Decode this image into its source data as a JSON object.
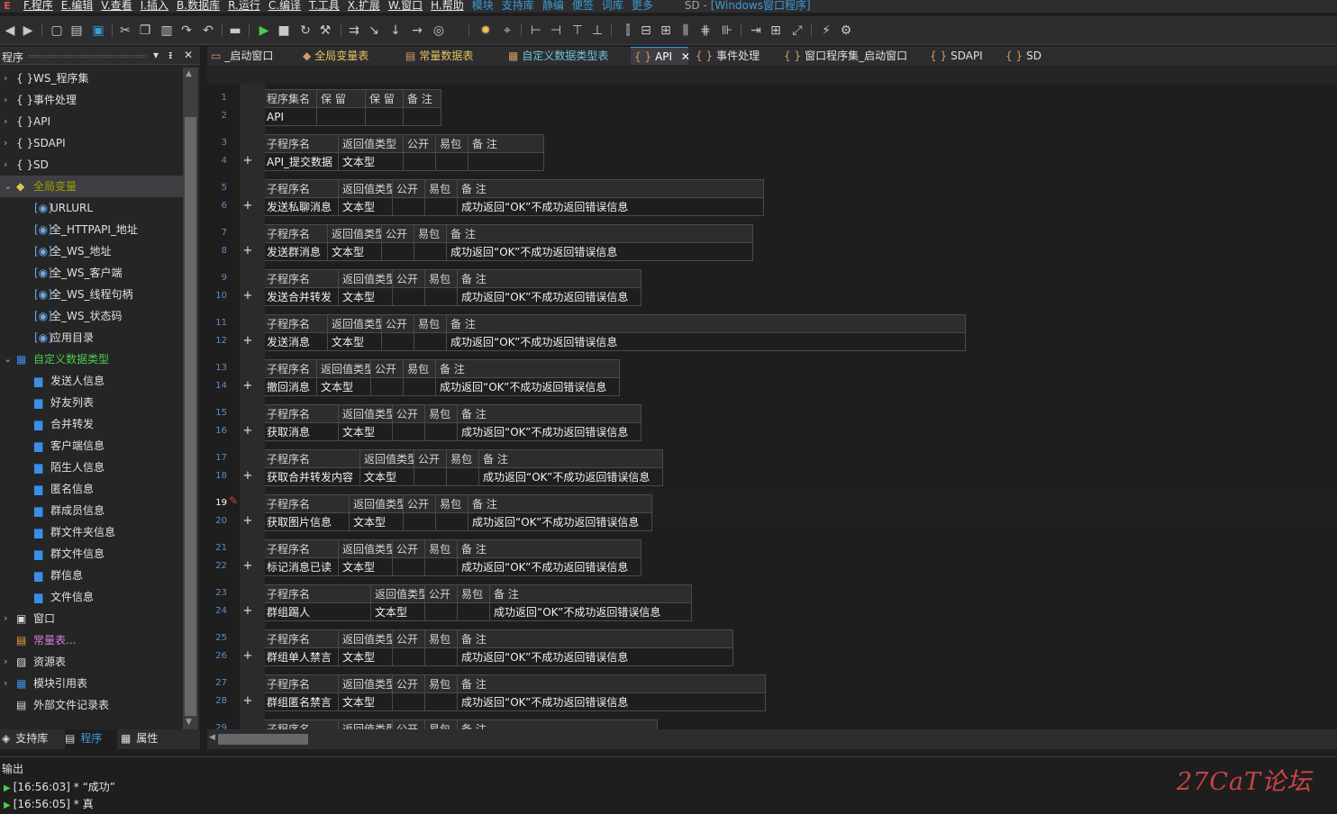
{
  "menu": {
    "items": [
      "F.程序",
      "E.编辑",
      "V.查看",
      "I.插入",
      "B.数据库",
      "R.运行",
      "C.编译",
      "T.工具",
      "X.扩展",
      "W.窗口",
      "H.帮助"
    ],
    "extra": [
      "模块",
      "支持库",
      "静编",
      "便签",
      "词库",
      "更多"
    ],
    "title_prefix": "SD - ",
    "title_window": "[Windows窗口程序]"
  },
  "left_panel": {
    "title": "程序",
    "pin": "▾ ᵻ ✕",
    "tree": [
      {
        "label": "WS_程序集",
        "icon": "{ }",
        "arrow": "›",
        "level": 0,
        "style": ""
      },
      {
        "label": "事件处理",
        "icon": "{ }",
        "arrow": "›",
        "level": 0,
        "style": ""
      },
      {
        "label": "API",
        "icon": "{ }",
        "arrow": "›",
        "level": 0,
        "style": ""
      },
      {
        "label": "SDAPI",
        "icon": "{ }",
        "arrow": "›",
        "level": 0,
        "style": ""
      },
      {
        "label": "SD",
        "icon": "{ }",
        "arrow": "›",
        "level": 0,
        "style": ""
      },
      {
        "label": "全局变量",
        "icon": "◆",
        "arrow": "⌄",
        "level": 0,
        "style": "olive",
        "selected": true
      },
      {
        "label": "URLURL",
        "icon": "[◉]",
        "level": 1,
        "style": ""
      },
      {
        "label": "全_HTTPAPI_地址",
        "icon": "[◉]",
        "level": 1,
        "style": ""
      },
      {
        "label": "全_WS_地址",
        "icon": "[◉]",
        "level": 1,
        "style": ""
      },
      {
        "label": "全_WS_客户端",
        "icon": "[◉]",
        "level": 1,
        "style": ""
      },
      {
        "label": "全_WS_线程句柄",
        "icon": "[◉]",
        "level": 1,
        "style": ""
      },
      {
        "label": "全_WS_状态码",
        "icon": "[◉]",
        "level": 1,
        "style": ""
      },
      {
        "label": "应用目录",
        "icon": "[◉]",
        "level": 1,
        "style": ""
      },
      {
        "label": "自定义数据类型",
        "icon": "▦",
        "arrow": "⌄",
        "level": 0,
        "style": "green"
      },
      {
        "label": "发送人信息",
        "icon": "▆",
        "level": 1,
        "style": ""
      },
      {
        "label": "好友列表",
        "icon": "▆",
        "level": 1,
        "style": ""
      },
      {
        "label": "合并转发",
        "icon": "▆",
        "level": 1,
        "style": ""
      },
      {
        "label": "客户端信息",
        "icon": "▆",
        "level": 1,
        "style": ""
      },
      {
        "label": "陌生人信息",
        "icon": "▆",
        "level": 1,
        "style": ""
      },
      {
        "label": "匿名信息",
        "icon": "▆",
        "level": 1,
        "style": ""
      },
      {
        "label": "群成员信息",
        "icon": "▆",
        "level": 1,
        "style": ""
      },
      {
        "label": "群文件夹信息",
        "icon": "▆",
        "level": 1,
        "style": ""
      },
      {
        "label": "群文件信息",
        "icon": "▆",
        "level": 1,
        "style": ""
      },
      {
        "label": "群信息",
        "icon": "▆",
        "level": 1,
        "style": ""
      },
      {
        "label": "文件信息",
        "icon": "▆",
        "level": 1,
        "style": ""
      },
      {
        "label": "窗口",
        "icon": "▣",
        "arrow": "›",
        "level": 0,
        "style": ""
      },
      {
        "label": "常量表...",
        "icon": "▤",
        "level": 0,
        "style": "purple"
      },
      {
        "label": "资源表",
        "icon": "▨",
        "arrow": "›",
        "level": 0,
        "style": ""
      },
      {
        "label": "模块引用表",
        "icon": "▦",
        "arrow": "›",
        "level": 0,
        "style": ""
      },
      {
        "label": "外部文件记录表",
        "icon": "▤",
        "level": 0,
        "style": ""
      }
    ],
    "bottom_tabs": [
      "支持库",
      "程序",
      "属性"
    ]
  },
  "doc_tabs": [
    {
      "label": "_启动窗口",
      "icon": "▭",
      "style": ""
    },
    {
      "label": "全局变量表",
      "icon": "◆",
      "style": "yellow"
    },
    {
      "label": "常量数据表",
      "icon": "▤",
      "style": "yellow"
    },
    {
      "label": "自定义数据类型表",
      "icon": "▦",
      "style": "cyan"
    },
    {
      "label": "API",
      "icon": "{ }",
      "style": "active",
      "close": "✕"
    },
    {
      "label": "事件处理",
      "icon": "{ }",
      "style": ""
    },
    {
      "label": "窗口程序集_启动窗口",
      "icon": "{ }",
      "style": ""
    },
    {
      "label": "SDAPI",
      "icon": "{ }",
      "style": ""
    },
    {
      "label": "SD",
      "icon": "{ }",
      "style": ""
    }
  ],
  "editor": {
    "assembly_header": [
      "程序集名",
      "保 留",
      "保 留",
      "备 注"
    ],
    "assembly_row": [
      "API",
      "",
      "",
      ""
    ],
    "sub_header": [
      "子程序名",
      "返回值类型",
      "公开",
      "易包",
      "备 注"
    ],
    "subs": [
      {
        "name": "API_提交数据",
        "type": "文本型",
        "note": ""
      },
      {
        "name": "发送私聊消息",
        "type": "文本型",
        "note": "成功返回“OK”不成功返回错误信息"
      },
      {
        "name": "发送群消息",
        "type": "文本型",
        "note": "成功返回“OK”不成功返回错误信息"
      },
      {
        "name": "发送合并转发",
        "type": "文本型",
        "note": "成功返回“OK”不成功返回错误信息"
      },
      {
        "name": "发送消息",
        "type": "文本型",
        "note": "成功返回“OK”不成功返回错误信息"
      },
      {
        "name": "撤回消息",
        "type": "文本型",
        "note": "成功返回“OK”不成功返回错误信息"
      },
      {
        "name": "获取消息",
        "type": "文本型",
        "note": "成功返回“OK”不成功返回错误信息"
      },
      {
        "name": "获取合并转发内容",
        "type": "文本型",
        "note": "成功返回“OK”不成功返回错误信息"
      },
      {
        "name": "获取图片信息",
        "type": "文本型",
        "note": "成功返回“OK”不成功返回错误信息"
      },
      {
        "name": "标记消息已读",
        "type": "文本型",
        "note": "成功返回“OK”不成功返回错误信息"
      },
      {
        "name": "群组踢人",
        "type": "文本型",
        "note": "成功返回“OK”不成功返回错误信息"
      },
      {
        "name": "群组单人禁言",
        "type": "文本型",
        "note": "成功返回“OK”不成功返回错误信息"
      },
      {
        "name": "群组匿名禁言",
        "type": "文本型",
        "note": "成功返回“OK”不成功返回错误信息"
      },
      {
        "name": "",
        "type": "",
        "note": ""
      }
    ],
    "line_numbers": [
      "1",
      "2",
      "3",
      "4",
      "5",
      "6",
      "7",
      "8",
      "9",
      "10",
      "11",
      "12",
      "13",
      "14",
      "15",
      "16",
      "17",
      "18",
      "19",
      "20",
      "21",
      "22",
      "23",
      "24",
      "25",
      "26",
      "27",
      "28",
      "29"
    ],
    "current_line": "19",
    "plus": "+"
  },
  "output": {
    "title": "输出",
    "lines": [
      "[16:56:03] * “成功”",
      "[16:56:05] * 真"
    ]
  },
  "watermark": "27CaT论坛"
}
